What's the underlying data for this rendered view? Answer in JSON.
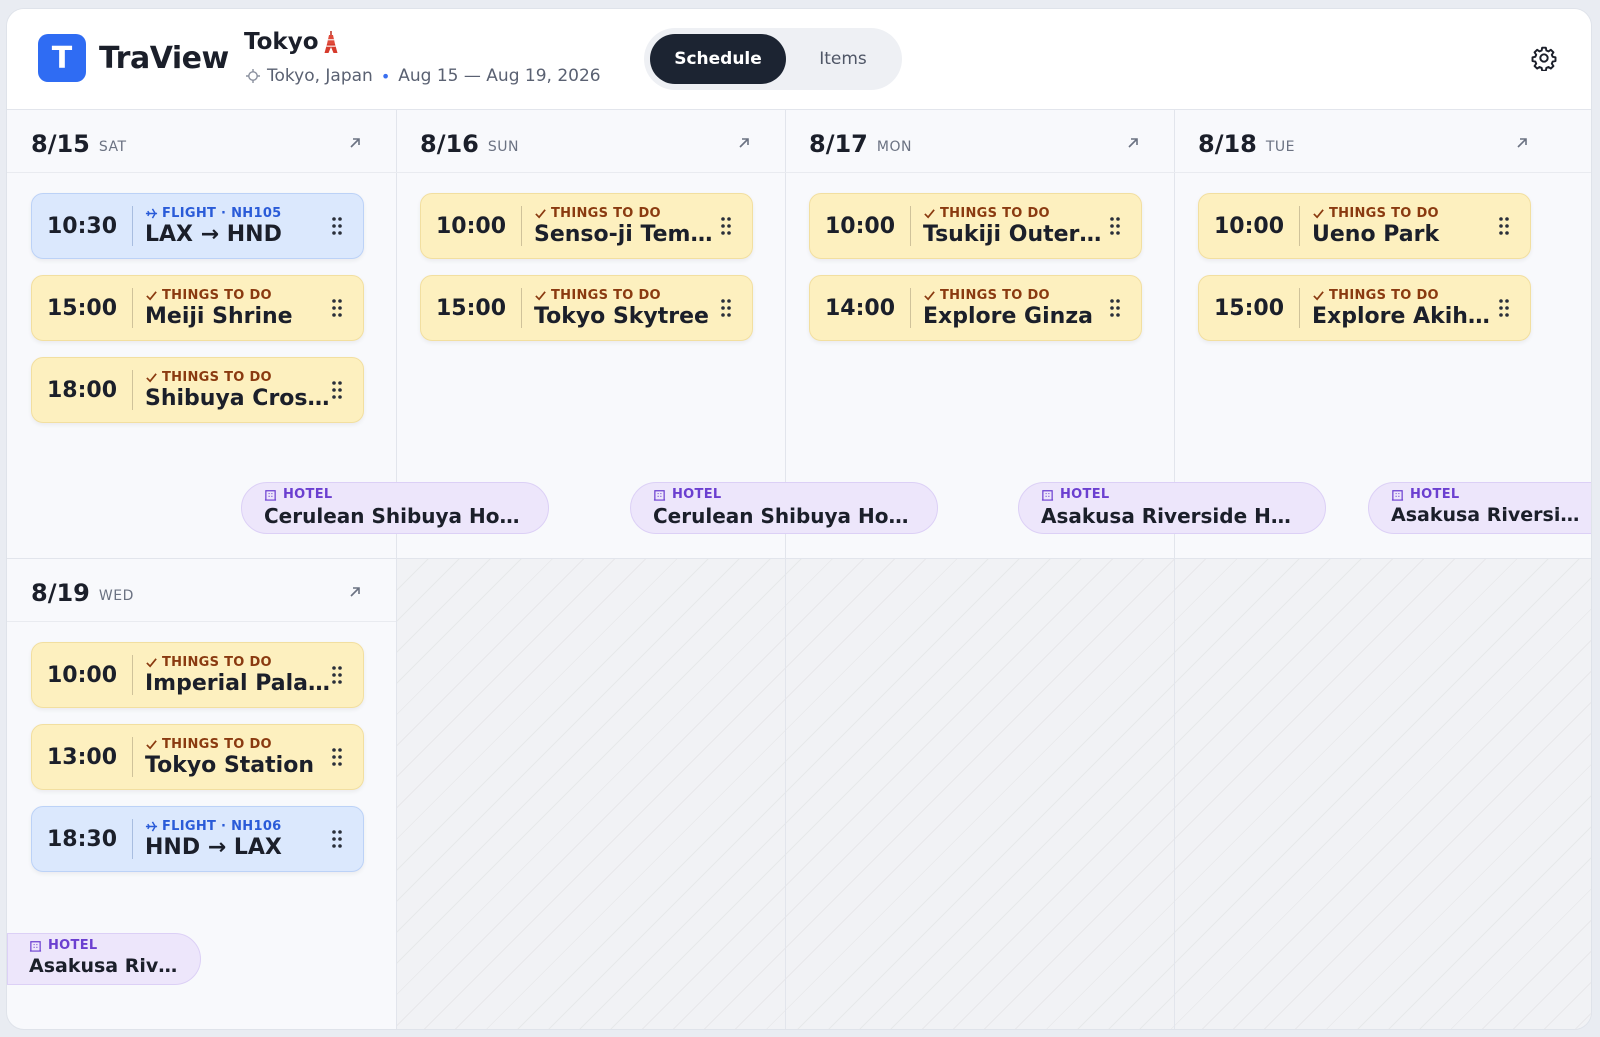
{
  "app": {
    "brand": "TraView",
    "logo_letter": "T"
  },
  "trip": {
    "title": "Tokyo",
    "location": "Tokyo, Japan",
    "dates": "Aug 15 — Aug 19, 2026"
  },
  "tabs": {
    "schedule": "Schedule",
    "items": "Items",
    "active": "Schedule"
  },
  "colors": {
    "accent": "#2f6cf3",
    "todo_bg": "#fdf0bf",
    "flight_bg": "#dbe8fd",
    "hotel_bg": "#ede6fb"
  },
  "days": [
    {
      "date": "8/15",
      "dow": "SAT",
      "events": [
        {
          "time": "10:30",
          "kind": "FLIGHT · NH105",
          "title": "LAX → HND",
          "type": "flight"
        },
        {
          "time": "15:00",
          "kind": "THINGS TO DO",
          "title": "Meiji Shrine",
          "type": "todo"
        },
        {
          "time": "18:00",
          "kind": "THINGS TO DO",
          "title": "Shibuya Crossing",
          "type": "todo"
        }
      ],
      "hotel": {
        "kind": "HOTEL",
        "name": "Cerulean Shibuya Hotel"
      }
    },
    {
      "date": "8/16",
      "dow": "SUN",
      "events": [
        {
          "time": "10:00",
          "kind": "THINGS TO DO",
          "title": "Senso-ji Temple",
          "type": "todo"
        },
        {
          "time": "15:00",
          "kind": "THINGS TO DO",
          "title": "Tokyo Skytree",
          "type": "todo"
        }
      ],
      "hotel": {
        "kind": "HOTEL",
        "name": "Cerulean Shibuya Hotel"
      }
    },
    {
      "date": "8/17",
      "dow": "MON",
      "events": [
        {
          "time": "10:00",
          "kind": "THINGS TO DO",
          "title": "Tsukiji Outer Market",
          "type": "todo"
        },
        {
          "time": "14:00",
          "kind": "THINGS TO DO",
          "title": "Explore Ginza",
          "type": "todo"
        }
      ],
      "hotel": {
        "kind": "HOTEL",
        "name": "Asakusa Riverside Hotel"
      }
    },
    {
      "date": "8/18",
      "dow": "TUE",
      "events": [
        {
          "time": "10:00",
          "kind": "THINGS TO DO",
          "title": "Ueno Park",
          "type": "todo"
        },
        {
          "time": "15:00",
          "kind": "THINGS TO DO",
          "title": "Explore Akihabara",
          "type": "todo"
        }
      ],
      "hotel": {
        "kind": "HOTEL",
        "name": "Asakusa Riverside Hotel"
      }
    },
    {
      "date": "8/19",
      "dow": "WED",
      "events": [
        {
          "time": "10:00",
          "kind": "THINGS TO DO",
          "title": "Imperial Palace",
          "type": "todo"
        },
        {
          "time": "13:00",
          "kind": "THINGS TO DO",
          "title": "Tokyo Station",
          "type": "todo"
        },
        {
          "time": "18:30",
          "kind": "FLIGHT · NH106",
          "title": "HND → LAX",
          "type": "flight"
        }
      ],
      "hotel": {
        "kind": "HOTEL",
        "name": "Asakusa Riverside Hotel"
      }
    }
  ]
}
